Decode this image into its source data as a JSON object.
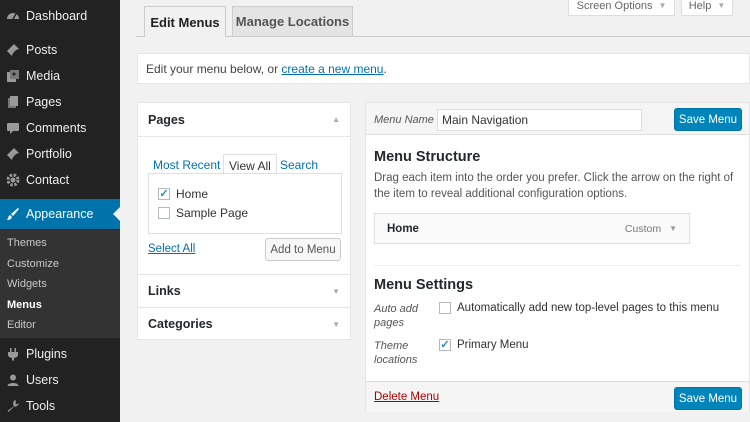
{
  "sidebar": {
    "items": [
      {
        "label": "Dashboard",
        "icon": "dashboard-icon"
      },
      {
        "label": "Posts",
        "icon": "pin-icon"
      },
      {
        "label": "Media",
        "icon": "media-icon"
      },
      {
        "label": "Pages",
        "icon": "pages-icon"
      },
      {
        "label": "Comments",
        "icon": "comment-icon"
      },
      {
        "label": "Portfolio",
        "icon": "pin-icon"
      },
      {
        "label": "Contact",
        "icon": "gear-icon"
      },
      {
        "label": "Appearance",
        "icon": "brush-icon"
      },
      {
        "label": "Plugins",
        "icon": "plug-icon"
      },
      {
        "label": "Users",
        "icon": "user-icon"
      },
      {
        "label": "Tools",
        "icon": "wrench-icon"
      }
    ],
    "submenu": [
      "Themes",
      "Customize",
      "Widgets",
      "Menus",
      "Editor"
    ]
  },
  "top": {
    "screen_options": "Screen Options",
    "help": "Help"
  },
  "tabs": {
    "edit_menus": "Edit Menus",
    "manage_locations": "Manage Locations"
  },
  "notice": {
    "text": "Edit your menu below, or ",
    "link": "create a new menu",
    "tail": "."
  },
  "left": {
    "pages_title": "Pages",
    "tabs": [
      "Most Recent",
      "View All",
      "Search"
    ],
    "pages": [
      {
        "label": "Home",
        "checked": true
      },
      {
        "label": "Sample Page",
        "checked": false
      }
    ],
    "select_all": "Select All",
    "add_to_menu": "Add to Menu",
    "links_title": "Links",
    "categories_title": "Categories"
  },
  "right": {
    "menu_name_label": "Menu Name",
    "menu_name_value": "Main Navigation",
    "save_label": "Save Menu",
    "structure_title": "Menu Structure",
    "structure_help": "Drag each item into the order you prefer. Click the arrow on the right of the item to reveal additional configuration options.",
    "item": {
      "title": "Home",
      "type": "Custom"
    },
    "settings_title": "Menu Settings",
    "auto_add_label": "Auto add pages",
    "auto_add_text": "Automatically add new top-level pages to this menu",
    "auto_add_checked": false,
    "theme_locations_label": "Theme locations",
    "primary_menu_text": "Primary Menu",
    "primary_menu_checked": true,
    "delete_label": "Delete Menu"
  },
  "colors": {
    "sidebar": "#222222",
    "active": "#0073aa",
    "primary_button": "#0085ba",
    "delete": "#aa0000"
  }
}
